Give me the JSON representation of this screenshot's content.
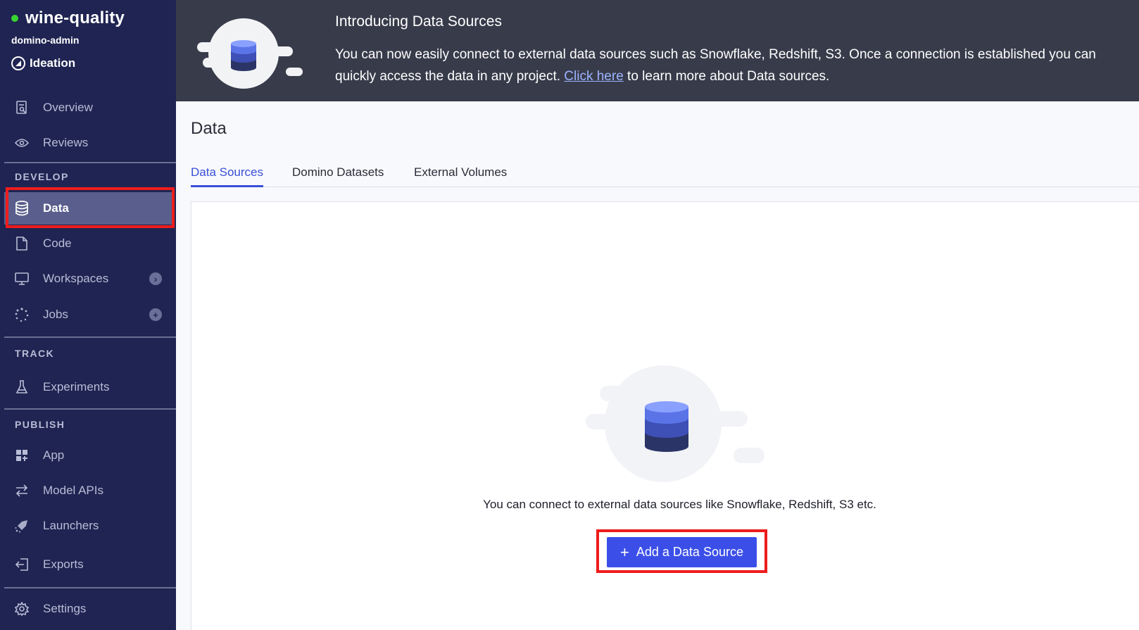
{
  "project": {
    "name": "wine-quality",
    "owner": "domino-admin",
    "stage": "Ideation"
  },
  "nav": {
    "overview": "Overview",
    "reviews": "Reviews",
    "develop_label": "DEVELOP",
    "data": "Data",
    "code": "Code",
    "workspaces": "Workspaces",
    "jobs": "Jobs",
    "track_label": "TRACK",
    "experiments": "Experiments",
    "publish_label": "PUBLISH",
    "app": "App",
    "model_apis": "Model APIs",
    "launchers": "Launchers",
    "exports": "Exports",
    "settings": "Settings"
  },
  "banner": {
    "title": "Introducing Data Sources",
    "text_before_link": "You can now easily connect to external data sources such as Snowflake, Redshift, S3. Once a connection is established you can quickly access the data in any project. ",
    "link": "Click here",
    "text_after_link": " to learn more about Data sources."
  },
  "page": {
    "title": "Data",
    "tabs": [
      "Data Sources",
      "Domino Datasets",
      "External Volumes"
    ],
    "active_tab": "Data Sources"
  },
  "empty_state": {
    "message": "You can connect to external data sources like Snowflake, Redshift, S3 etc.",
    "button_label": "Add a Data Source"
  },
  "colors": {
    "sidebar_bg": "#1f2452",
    "banner_bg": "#383b4a",
    "accent": "#3b4fe8",
    "highlight": "#ee1c1c",
    "status_green": "#38d430"
  }
}
